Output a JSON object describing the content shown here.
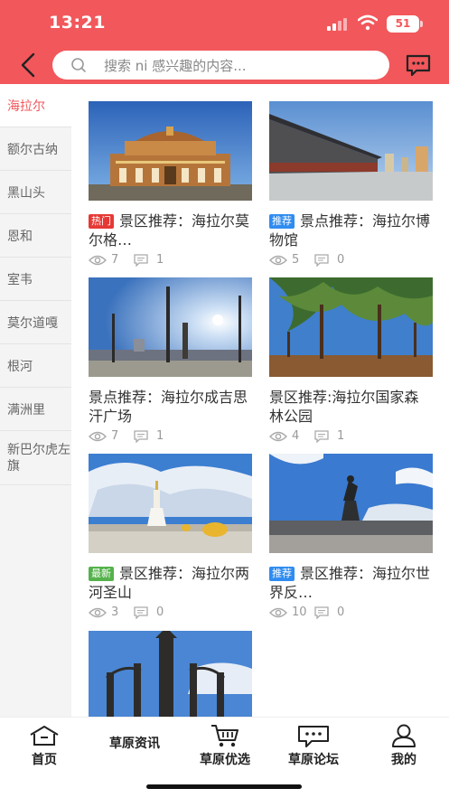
{
  "status": {
    "time": "13:21",
    "battery": "51"
  },
  "search": {
    "placeholder": "搜索 ni 感兴趣的内容..."
  },
  "sidebar": {
    "items": [
      {
        "label": "海拉尔",
        "active": true
      },
      {
        "label": "额尔古纳"
      },
      {
        "label": "黑山头"
      },
      {
        "label": "恩和"
      },
      {
        "label": "室韦"
      },
      {
        "label": "莫尔道嘎"
      },
      {
        "label": "根河"
      },
      {
        "label": "满洲里"
      },
      {
        "label": "新巴尔虎左旗"
      }
    ]
  },
  "cards": [
    {
      "badge": "热门",
      "badge_color": "#e53935",
      "title": "景区推荐：海拉尔莫尔格…",
      "views": "7",
      "comments": "1"
    },
    {
      "badge": "推荐",
      "badge_color": "#2f8cf0",
      "title": "景点推荐：海拉尔博物馆",
      "views": "5",
      "comments": "0"
    },
    {
      "badge": "",
      "title": "景点推荐：海拉尔成吉思汗广场",
      "views": "7",
      "comments": "1"
    },
    {
      "badge": "",
      "title": "景区推荐:海拉尔国家森林公园",
      "views": "4",
      "comments": "1"
    },
    {
      "badge": "最新",
      "badge_color": "#55b24b",
      "title": "景区推荐：海拉尔两河圣山",
      "views": "3",
      "comments": "0"
    },
    {
      "badge": "推荐",
      "badge_color": "#2f8cf0",
      "title": "景区推荐：海拉尔世界反…",
      "views": "10",
      "comments": "0"
    }
  ],
  "bottom_nav": {
    "items": [
      {
        "label": "首页",
        "icon": "home-icon"
      },
      {
        "label": "草原资讯",
        "icon": "news-icon"
      },
      {
        "label": "草原优选",
        "icon": "cart-icon"
      },
      {
        "label": "草原论坛",
        "icon": "forum-icon"
      },
      {
        "label": "我的",
        "icon": "user-icon"
      }
    ]
  },
  "colors": {
    "brand": "#f2575b",
    "hot": "#e53935",
    "recommend": "#2f8cf0",
    "new": "#55b24b"
  }
}
